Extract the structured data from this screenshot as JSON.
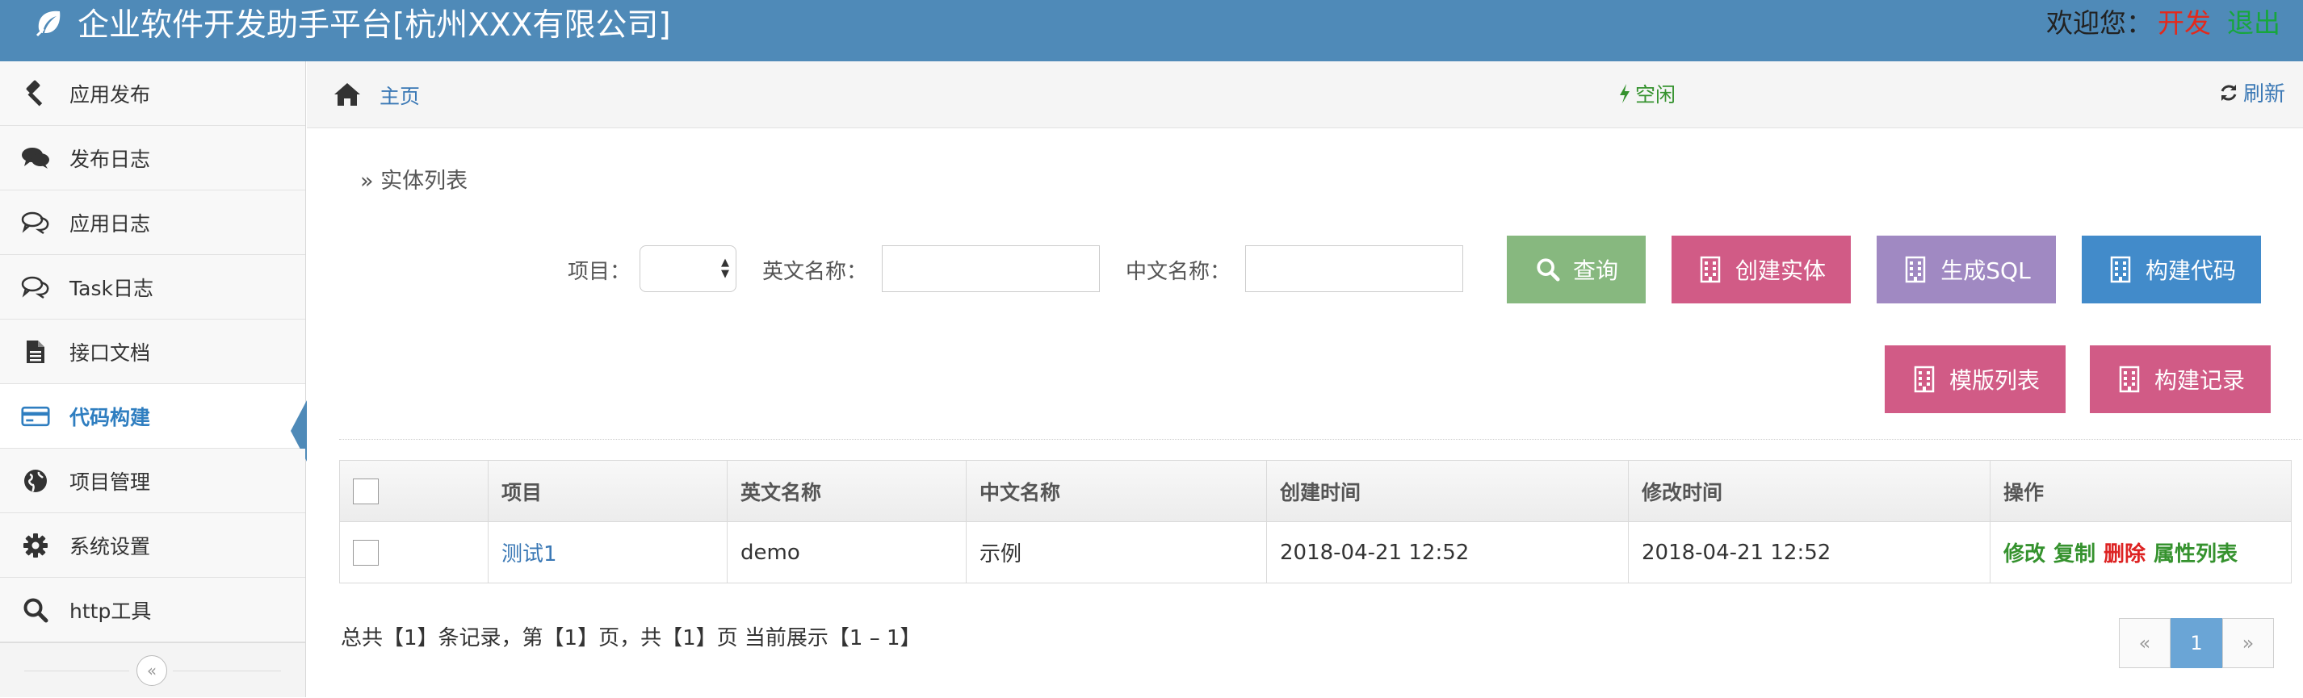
{
  "app": {
    "title": "企业软件开发助手平台[杭州XXX有限公司]",
    "welcome": "欢迎您：",
    "role": "开发",
    "logout": "退出"
  },
  "sidebar": {
    "items": [
      {
        "label": "应用发布",
        "icon": "gavel-icon"
      },
      {
        "label": "发布日志",
        "icon": "comments-icon"
      },
      {
        "label": "应用日志",
        "icon": "comments-outline-icon"
      },
      {
        "label": "Task日志",
        "icon": "comments-outline-icon"
      },
      {
        "label": "接口文档",
        "icon": "file-icon"
      },
      {
        "label": "代码构建",
        "icon": "credit-card-icon"
      },
      {
        "label": "项目管理",
        "icon": "globe-icon"
      },
      {
        "label": "系统设置",
        "icon": "gear-icon"
      },
      {
        "label": "http工具",
        "icon": "search-icon"
      }
    ],
    "active_index": 5,
    "collapse_glyph": "«"
  },
  "breadcrumb": {
    "home": "主页",
    "status": "空闲",
    "refresh": "刷新"
  },
  "section": {
    "title": "» 实体列表"
  },
  "filters": {
    "project_label": "项目：",
    "project_value": "",
    "en_name_label": "英文名称：",
    "en_name_value": "",
    "cn_name_label": "中文名称：",
    "cn_name_value": ""
  },
  "buttons": {
    "query": "查询",
    "create_entity": "创建实体",
    "gen_sql": "生成SQL",
    "build_code": "构建代码",
    "template_list": "模版列表",
    "build_record": "构建记录"
  },
  "table": {
    "columns": [
      "",
      "项目",
      "英文名称",
      "中文名称",
      "创建时间",
      "修改时间",
      "操作"
    ],
    "rows": [
      {
        "project": "测试1",
        "en_name": "demo",
        "cn_name": "示例",
        "created": "2018-04-21 12:52",
        "modified": "2018-04-21 12:52",
        "ops": [
          "修改",
          "复制",
          "删除",
          "属性列表"
        ]
      }
    ]
  },
  "summary": "总共【1】条记录，第【1】页，共【1】页  当前展示【1 – 1】",
  "pager": {
    "prev": "«",
    "current": "1",
    "next": "»"
  },
  "colors": {
    "navbar": "#4f8ab8",
    "query_btn": "#87b87f",
    "pink_btn": "#d15b86",
    "purple_btn": "#a089c2",
    "blue_btn": "#428bca"
  }
}
